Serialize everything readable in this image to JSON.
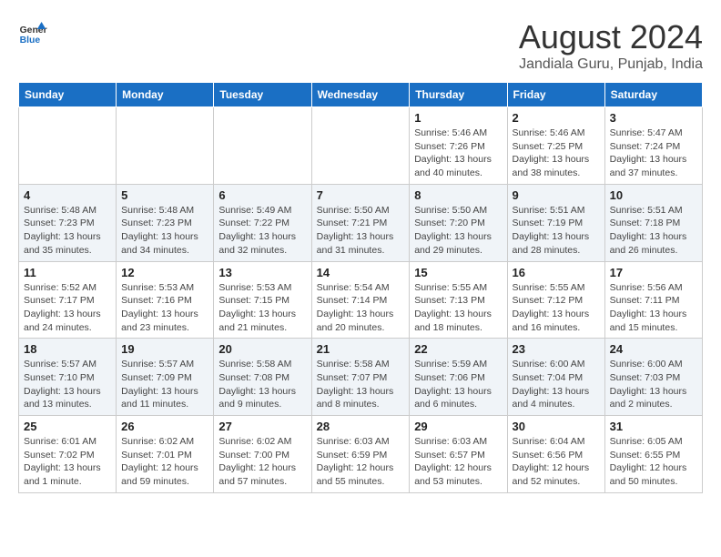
{
  "header": {
    "logo_general": "General",
    "logo_blue": "Blue",
    "title": "August 2024",
    "subtitle": "Jandiala Guru, Punjab, India"
  },
  "weekdays": [
    "Sunday",
    "Monday",
    "Tuesday",
    "Wednesday",
    "Thursday",
    "Friday",
    "Saturday"
  ],
  "weeks": [
    [
      {
        "day": "",
        "sunrise": "",
        "sunset": "",
        "daylight": ""
      },
      {
        "day": "",
        "sunrise": "",
        "sunset": "",
        "daylight": ""
      },
      {
        "day": "",
        "sunrise": "",
        "sunset": "",
        "daylight": ""
      },
      {
        "day": "",
        "sunrise": "",
        "sunset": "",
        "daylight": ""
      },
      {
        "day": "1",
        "sunrise": "Sunrise: 5:46 AM",
        "sunset": "Sunset: 7:26 PM",
        "daylight": "Daylight: 13 hours and 40 minutes."
      },
      {
        "day": "2",
        "sunrise": "Sunrise: 5:46 AM",
        "sunset": "Sunset: 7:25 PM",
        "daylight": "Daylight: 13 hours and 38 minutes."
      },
      {
        "day": "3",
        "sunrise": "Sunrise: 5:47 AM",
        "sunset": "Sunset: 7:24 PM",
        "daylight": "Daylight: 13 hours and 37 minutes."
      }
    ],
    [
      {
        "day": "4",
        "sunrise": "Sunrise: 5:48 AM",
        "sunset": "Sunset: 7:23 PM",
        "daylight": "Daylight: 13 hours and 35 minutes."
      },
      {
        "day": "5",
        "sunrise": "Sunrise: 5:48 AM",
        "sunset": "Sunset: 7:23 PM",
        "daylight": "Daylight: 13 hours and 34 minutes."
      },
      {
        "day": "6",
        "sunrise": "Sunrise: 5:49 AM",
        "sunset": "Sunset: 7:22 PM",
        "daylight": "Daylight: 13 hours and 32 minutes."
      },
      {
        "day": "7",
        "sunrise": "Sunrise: 5:50 AM",
        "sunset": "Sunset: 7:21 PM",
        "daylight": "Daylight: 13 hours and 31 minutes."
      },
      {
        "day": "8",
        "sunrise": "Sunrise: 5:50 AM",
        "sunset": "Sunset: 7:20 PM",
        "daylight": "Daylight: 13 hours and 29 minutes."
      },
      {
        "day": "9",
        "sunrise": "Sunrise: 5:51 AM",
        "sunset": "Sunset: 7:19 PM",
        "daylight": "Daylight: 13 hours and 28 minutes."
      },
      {
        "day": "10",
        "sunrise": "Sunrise: 5:51 AM",
        "sunset": "Sunset: 7:18 PM",
        "daylight": "Daylight: 13 hours and 26 minutes."
      }
    ],
    [
      {
        "day": "11",
        "sunrise": "Sunrise: 5:52 AM",
        "sunset": "Sunset: 7:17 PM",
        "daylight": "Daylight: 13 hours and 24 minutes."
      },
      {
        "day": "12",
        "sunrise": "Sunrise: 5:53 AM",
        "sunset": "Sunset: 7:16 PM",
        "daylight": "Daylight: 13 hours and 23 minutes."
      },
      {
        "day": "13",
        "sunrise": "Sunrise: 5:53 AM",
        "sunset": "Sunset: 7:15 PM",
        "daylight": "Daylight: 13 hours and 21 minutes."
      },
      {
        "day": "14",
        "sunrise": "Sunrise: 5:54 AM",
        "sunset": "Sunset: 7:14 PM",
        "daylight": "Daylight: 13 hours and 20 minutes."
      },
      {
        "day": "15",
        "sunrise": "Sunrise: 5:55 AM",
        "sunset": "Sunset: 7:13 PM",
        "daylight": "Daylight: 13 hours and 18 minutes."
      },
      {
        "day": "16",
        "sunrise": "Sunrise: 5:55 AM",
        "sunset": "Sunset: 7:12 PM",
        "daylight": "Daylight: 13 hours and 16 minutes."
      },
      {
        "day": "17",
        "sunrise": "Sunrise: 5:56 AM",
        "sunset": "Sunset: 7:11 PM",
        "daylight": "Daylight: 13 hours and 15 minutes."
      }
    ],
    [
      {
        "day": "18",
        "sunrise": "Sunrise: 5:57 AM",
        "sunset": "Sunset: 7:10 PM",
        "daylight": "Daylight: 13 hours and 13 minutes."
      },
      {
        "day": "19",
        "sunrise": "Sunrise: 5:57 AM",
        "sunset": "Sunset: 7:09 PM",
        "daylight": "Daylight: 13 hours and 11 minutes."
      },
      {
        "day": "20",
        "sunrise": "Sunrise: 5:58 AM",
        "sunset": "Sunset: 7:08 PM",
        "daylight": "Daylight: 13 hours and 9 minutes."
      },
      {
        "day": "21",
        "sunrise": "Sunrise: 5:58 AM",
        "sunset": "Sunset: 7:07 PM",
        "daylight": "Daylight: 13 hours and 8 minutes."
      },
      {
        "day": "22",
        "sunrise": "Sunrise: 5:59 AM",
        "sunset": "Sunset: 7:06 PM",
        "daylight": "Daylight: 13 hours and 6 minutes."
      },
      {
        "day": "23",
        "sunrise": "Sunrise: 6:00 AM",
        "sunset": "Sunset: 7:04 PM",
        "daylight": "Daylight: 13 hours and 4 minutes."
      },
      {
        "day": "24",
        "sunrise": "Sunrise: 6:00 AM",
        "sunset": "Sunset: 7:03 PM",
        "daylight": "Daylight: 13 hours and 2 minutes."
      }
    ],
    [
      {
        "day": "25",
        "sunrise": "Sunrise: 6:01 AM",
        "sunset": "Sunset: 7:02 PM",
        "daylight": "Daylight: 13 hours and 1 minute."
      },
      {
        "day": "26",
        "sunrise": "Sunrise: 6:02 AM",
        "sunset": "Sunset: 7:01 PM",
        "daylight": "Daylight: 12 hours and 59 minutes."
      },
      {
        "day": "27",
        "sunrise": "Sunrise: 6:02 AM",
        "sunset": "Sunset: 7:00 PM",
        "daylight": "Daylight: 12 hours and 57 minutes."
      },
      {
        "day": "28",
        "sunrise": "Sunrise: 6:03 AM",
        "sunset": "Sunset: 6:59 PM",
        "daylight": "Daylight: 12 hours and 55 minutes."
      },
      {
        "day": "29",
        "sunrise": "Sunrise: 6:03 AM",
        "sunset": "Sunset: 6:57 PM",
        "daylight": "Daylight: 12 hours and 53 minutes."
      },
      {
        "day": "30",
        "sunrise": "Sunrise: 6:04 AM",
        "sunset": "Sunset: 6:56 PM",
        "daylight": "Daylight: 12 hours and 52 minutes."
      },
      {
        "day": "31",
        "sunrise": "Sunrise: 6:05 AM",
        "sunset": "Sunset: 6:55 PM",
        "daylight": "Daylight: 12 hours and 50 minutes."
      }
    ]
  ]
}
